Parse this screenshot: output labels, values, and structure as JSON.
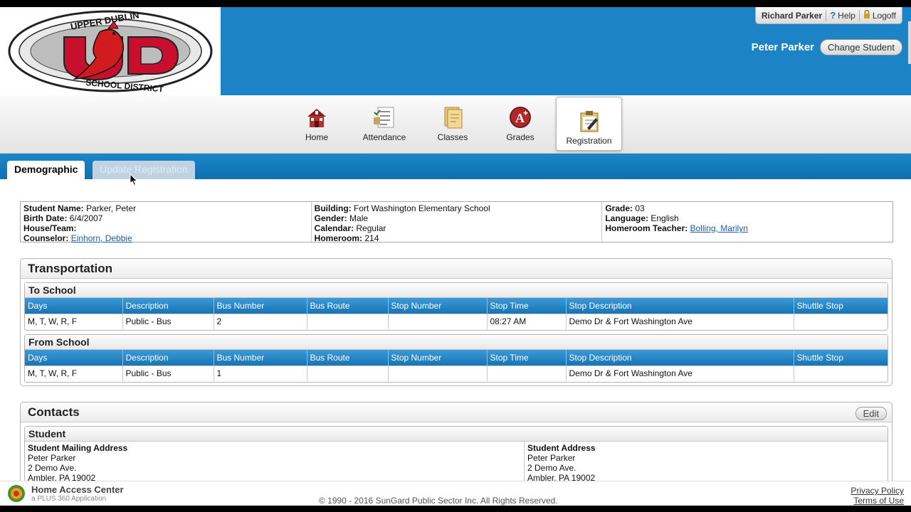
{
  "header": {
    "logo_alt": "UPPER DUBLIN SCHOOL DISTRICT",
    "user_name": "Richard Parker",
    "help_label": "Help",
    "logoff_label": "Logoff",
    "student_name": "Peter Parker",
    "change_student_label": "Change Student",
    "brand_color": "#1c84c6"
  },
  "nav": {
    "items": [
      {
        "label": "Home",
        "icon": "school-house-icon"
      },
      {
        "label": "Attendance",
        "icon": "attendance-checklist-icon"
      },
      {
        "label": "Classes",
        "icon": "classes-folder-icon"
      },
      {
        "label": "Grades",
        "icon": "grade-a-plus-icon"
      },
      {
        "label": "Registration",
        "icon": "registration-clipboard-icon",
        "active": true
      }
    ]
  },
  "tabs": {
    "demographic": "Demographic",
    "update_registration": "Update Registration"
  },
  "demographics": {
    "student_name_label": "Student Name:",
    "student_name": "Parker, Peter",
    "birth_date_label": "Birth Date:",
    "birth_date": "6/4/2007",
    "house_team_label": "House/Team:",
    "counselor_label": "Counselor:",
    "counselor": "Einhorn, Debbie",
    "building_label": "Building:",
    "building": "Fort Washington Elementary School",
    "gender_label": "Gender:",
    "gender": "Male",
    "calendar_label": "Calendar:",
    "calendar": "Regular",
    "homeroom_label": "Homeroom:",
    "homeroom": "214",
    "grade_label": "Grade:",
    "grade": "03",
    "language_label": "Language:",
    "language": "English",
    "homeroom_teacher_label": "Homeroom Teacher:",
    "homeroom_teacher": "Bolling, Marilyn"
  },
  "transportation": {
    "title": "Transportation",
    "columns": [
      "Days",
      "Description",
      "Bus Number",
      "Bus Route",
      "Stop Number",
      "Stop Time",
      "Stop Description",
      "Shuttle Stop"
    ],
    "to_school": {
      "title": "To School",
      "rows": [
        [
          "M, T, W, R, F",
          "Public - Bus",
          "2",
          "",
          "",
          "08:27 AM",
          "Demo Dr & Fort Washington Ave",
          ""
        ]
      ]
    },
    "from_school": {
      "title": "From School",
      "rows": [
        [
          "M, T, W, R, F",
          "Public - Bus",
          "1",
          "",
          "",
          "",
          "Demo Dr & Fort Washington Ave",
          ""
        ]
      ]
    }
  },
  "contacts": {
    "title": "Contacts",
    "edit_label": "Edit",
    "student": {
      "title": "Student",
      "mailing_label": "Student Mailing Address",
      "mailing": [
        "Peter Parker",
        "2 Demo Ave.",
        "Ambler, PA 19002"
      ],
      "address_label": "Student Address",
      "address": [
        "Peter Parker",
        "2 Demo Ave.",
        "Ambler, PA 19002"
      ]
    }
  },
  "footer": {
    "title": "Home Access Center",
    "subtitle": "a PLUS 360 Application",
    "logo_text": "PLUS 360",
    "copyright": "© 1990 - 2016 SunGard Public Sector Inc. All Rights Reserved.",
    "privacy": "Privacy Policy",
    "terms": "Terms of Use"
  }
}
